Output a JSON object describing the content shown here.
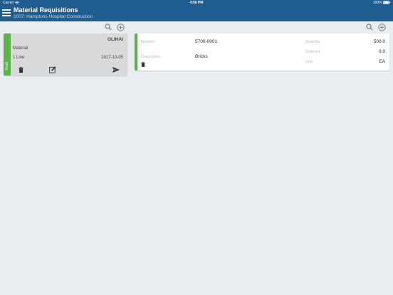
{
  "status_bar": {
    "carrier": "Carrier",
    "time": "4:56 PM",
    "battery": "100%"
  },
  "header": {
    "title": "Material Requisitions",
    "subtitle": "1007: Hamptons Hospital Construction"
  },
  "requisition": {
    "status": "Draft",
    "code": "OLIHAI",
    "type": "Material",
    "lines": "1 Line",
    "date": "2017-10-05",
    "status_color": "#5cb34a"
  },
  "line_item": {
    "number_label": "Number",
    "number": "5700-0001",
    "description_label": "Description",
    "description": "Bricks",
    "quantity_label": "Quantity",
    "quantity": "500.0",
    "ordered_label": "Ordered",
    "ordered": "0.0",
    "unit_label": "Unit",
    "unit": "EA"
  },
  "colors": {
    "brand": "#1f5c8f",
    "accent": "#5cb34a",
    "background": "#e9edf0"
  },
  "icons": [
    "menu-icon",
    "search-icon",
    "add-icon",
    "trash-icon",
    "edit-icon",
    "send-icon",
    "wifi-icon",
    "battery-icon"
  ]
}
